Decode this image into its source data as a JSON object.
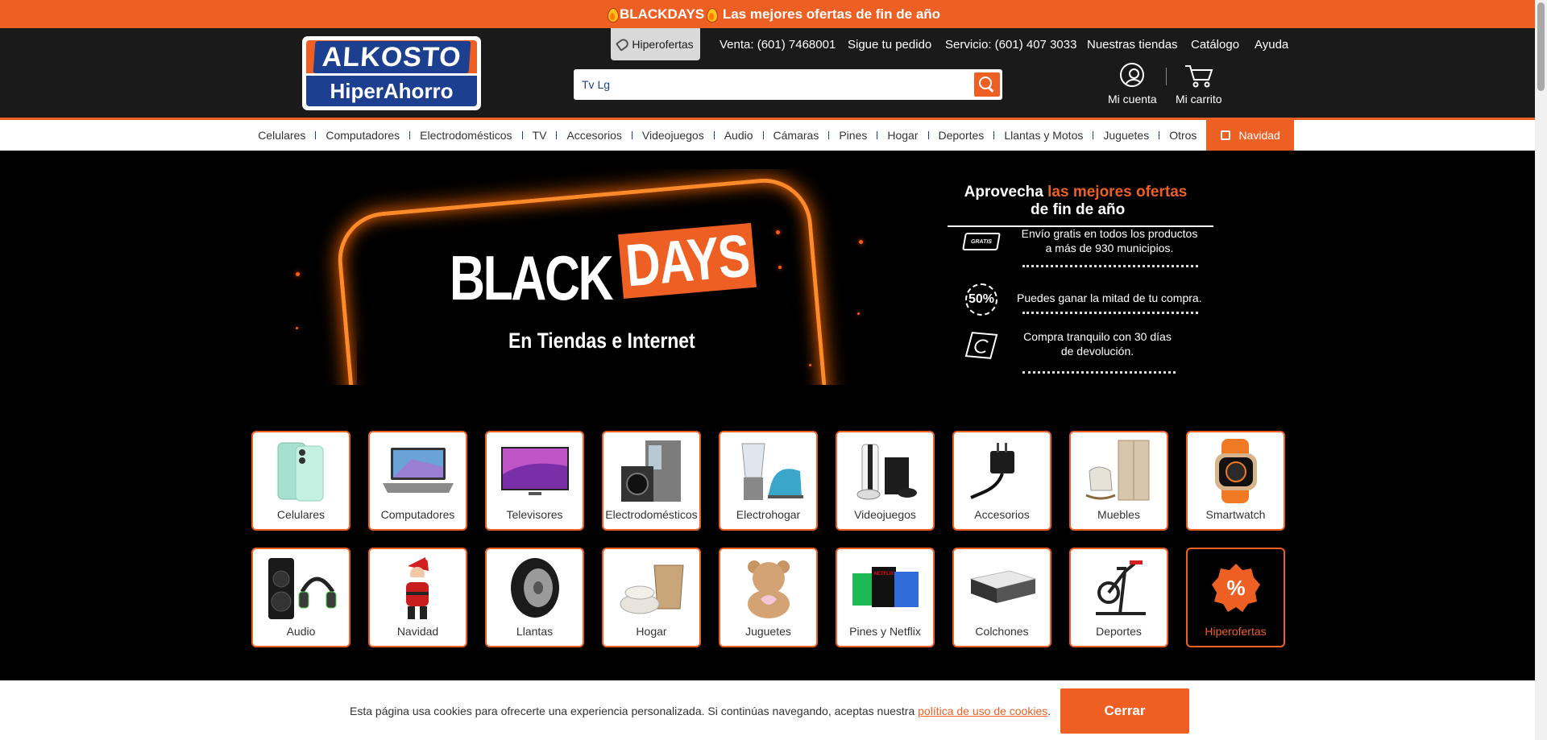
{
  "promo": {
    "text": "BLACKDAYS",
    "tail": " Las mejores ofertas de fin de año"
  },
  "logo": {
    "top": "ALKOSTO",
    "bottom": "HiperAhorro"
  },
  "topnav": {
    "hiperofertas": "Hiperofertas",
    "items": [
      "Venta: (601) 7468001",
      "Sigue tu pedido",
      "Servicio: (601) 407 3033",
      "Nuestras tiendas",
      "Catálogo",
      "Ayuda"
    ]
  },
  "search": {
    "value": "Tv Lg"
  },
  "account": {
    "mi_cuenta": "Mi cuenta",
    "mi_carrito": "Mi carrito"
  },
  "catnav": {
    "items": [
      "Celulares",
      "Computadores",
      "Electrodomésticos",
      "TV",
      "Accesorios",
      "Videojuegos",
      "Audio",
      "Cámaras",
      "Pines",
      "Hogar",
      "Deportes",
      "Llantas y Motos",
      "Juguetes",
      "Otros"
    ],
    "navidad": "Navidad"
  },
  "hero": {
    "black": "BLACK",
    "days": "DAYS",
    "subtitle": "En Tiendas e Internet"
  },
  "benefits": {
    "title_a": "Aprovecha ",
    "title_hl": "las mejores ofertas",
    "title_b": " de fin de año",
    "truck_label": "GRATIS",
    "badge_label": "50%",
    "items": [
      "Envío gratis en todos los productos a más de 930 municipios.",
      "Puedes ganar la mitad de tu compra.",
      "Compra tranquilo con 30 días de devolución."
    ]
  },
  "tiles": [
    "Celulares",
    "Computadores",
    "Televisores",
    "Electrodomésticos",
    "Electrohogar",
    "Videojuegos",
    "Accesorios",
    "Muebles",
    "Smartwatch",
    "Audio",
    "Navidad",
    "Llantas",
    "Hogar",
    "Juguetes",
    "Pines y Netflix",
    "Colchones",
    "Deportes",
    "Hiperofertas"
  ],
  "tile_extra": {
    "netflix": "NETFLIX",
    "hiper_pct": "%"
  },
  "cookie": {
    "text": "Esta página usa cookies para ofrecerte una experiencia personalizada. Si continúas navegando, aceptas nuestra ",
    "link": "política de uso de cookies",
    "end": ".",
    "button": "Cerrar"
  },
  "colors": {
    "accent": "#ee5f24",
    "brand_blue": "#1d3f8f",
    "header_bg": "#1a1a1a"
  }
}
